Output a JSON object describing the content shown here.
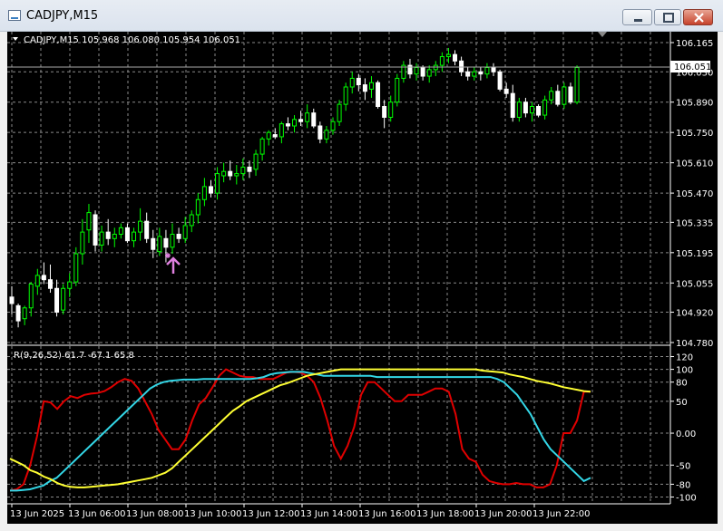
{
  "window": {
    "title": "CADJPY,M15"
  },
  "main": {
    "symbol_header": "CADJPY,M15  105.968 106.080 105.954 106.051",
    "price_axis_labels": [
      "106.165",
      "106.030",
      "105.890",
      "105.750",
      "105.610",
      "105.470",
      "105.335",
      "105.195",
      "105.055",
      "104.920",
      "104.780"
    ],
    "current_price_label": "106.051"
  },
  "indicator": {
    "header": "R(9,26,52) 61.7 -67.1 65.8",
    "axis_labels": [
      "120",
      "100",
      "80",
      "50",
      "0.00",
      "-50",
      "-80",
      "-100"
    ]
  },
  "time_axis": {
    "labels": [
      "13 Jun 2025",
      "13 Jun 06:00",
      "13 Jun 08:00",
      "13 Jun 10:00",
      "13 Jun 12:00",
      "13 Jun 14:00",
      "13 Jun 16:00",
      "13 Jun 18:00",
      "13 Jun 20:00",
      "13 Jun 22:00"
    ]
  },
  "colors": {
    "background": "#000000",
    "grid": "#8a8a8a",
    "bull_candle": "#00ff00",
    "bear_candle": "#ffffff",
    "red_line": "#e00000",
    "cyan_line": "#33d6e6",
    "yellow_line": "#ffff33",
    "arrow": "#e080e0"
  },
  "chart_data": {
    "type": "candlestick",
    "ohlc": [
      [
        104.99,
        105.04,
        104.91,
        104.96
      ],
      [
        104.95,
        104.96,
        104.85,
        104.88
      ],
      [
        104.89,
        104.95,
        104.86,
        104.94
      ],
      [
        104.94,
        105.06,
        104.9,
        105.05
      ],
      [
        105.04,
        105.12,
        105.0,
        105.09
      ],
      [
        105.09,
        105.15,
        105.05,
        105.07
      ],
      [
        105.07,
        105.14,
        105.01,
        105.03
      ],
      [
        105.03,
        105.07,
        104.9,
        104.92
      ],
      [
        104.93,
        105.05,
        104.91,
        105.03
      ],
      [
        105.03,
        105.1,
        104.99,
        105.06
      ],
      [
        105.06,
        105.22,
        105.04,
        105.19
      ],
      [
        105.19,
        105.35,
        105.14,
        105.29
      ],
      [
        105.3,
        105.42,
        105.24,
        105.38
      ],
      [
        105.37,
        105.39,
        105.2,
        105.23
      ],
      [
        105.23,
        105.32,
        105.2,
        105.29
      ],
      [
        105.29,
        105.35,
        105.23,
        105.26
      ],
      [
        105.26,
        105.31,
        105.22,
        105.28
      ],
      [
        105.28,
        105.33,
        105.26,
        105.31
      ],
      [
        105.31,
        105.33,
        105.24,
        105.25
      ],
      [
        105.25,
        105.31,
        105.22,
        105.29
      ],
      [
        105.29,
        105.4,
        105.25,
        105.34
      ],
      [
        105.34,
        105.38,
        105.24,
        105.26
      ],
      [
        105.26,
        105.3,
        105.17,
        105.21
      ],
      [
        105.2,
        105.31,
        105.18,
        105.27
      ],
      [
        105.26,
        105.3,
        105.15,
        105.22
      ],
      [
        105.22,
        105.33,
        105.19,
        105.28
      ],
      [
        105.28,
        105.31,
        105.24,
        105.26
      ],
      [
        105.26,
        105.36,
        105.24,
        105.32
      ],
      [
        105.32,
        105.39,
        105.29,
        105.37
      ],
      [
        105.37,
        105.47,
        105.33,
        105.44
      ],
      [
        105.44,
        105.54,
        105.41,
        105.5
      ],
      [
        105.5,
        105.53,
        105.45,
        105.47
      ],
      [
        105.47,
        105.59,
        105.44,
        105.56
      ],
      [
        105.55,
        105.61,
        105.52,
        105.57
      ],
      [
        105.57,
        105.62,
        105.53,
        105.55
      ],
      [
        105.55,
        105.6,
        105.51,
        105.56
      ],
      [
        105.56,
        105.63,
        105.53,
        105.59
      ],
      [
        105.59,
        105.62,
        105.54,
        105.57
      ],
      [
        105.58,
        105.67,
        105.55,
        105.65
      ],
      [
        105.65,
        105.73,
        105.62,
        105.72
      ],
      [
        105.72,
        105.76,
        105.69,
        105.75
      ],
      [
        105.74,
        105.77,
        105.72,
        105.73
      ],
      [
        105.73,
        105.8,
        105.7,
        105.79
      ],
      [
        105.79,
        105.82,
        105.76,
        105.78
      ],
      [
        105.78,
        105.83,
        105.75,
        105.81
      ],
      [
        105.81,
        105.85,
        105.78,
        105.8
      ],
      [
        105.8,
        105.88,
        105.77,
        105.84
      ],
      [
        105.84,
        105.86,
        105.77,
        105.78
      ],
      [
        105.78,
        105.8,
        105.7,
        105.72
      ],
      [
        105.72,
        105.78,
        105.7,
        105.76
      ],
      [
        105.76,
        105.82,
        105.74,
        105.8
      ],
      [
        105.8,
        105.9,
        105.78,
        105.88
      ],
      [
        105.88,
        105.98,
        105.85,
        105.96
      ],
      [
        105.96,
        106.03,
        105.93,
        106.0
      ],
      [
        106.0,
        106.02,
        105.94,
        105.97
      ],
      [
        105.97,
        106.0,
        105.9,
        105.94
      ],
      [
        105.95,
        106.01,
        105.91,
        105.98
      ],
      [
        105.98,
        105.99,
        105.86,
        105.87
      ],
      [
        105.87,
        105.9,
        105.77,
        105.82
      ],
      [
        105.82,
        105.92,
        105.8,
        105.89
      ],
      [
        105.89,
        106.02,
        105.87,
        106.0
      ],
      [
        106.0,
        106.08,
        105.98,
        106.06
      ],
      [
        106.06,
        106.09,
        106.0,
        106.02
      ],
      [
        106.02,
        106.07,
        105.99,
        106.05
      ],
      [
        106.05,
        106.06,
        105.99,
        106.01
      ],
      [
        106.01,
        106.06,
        105.98,
        106.04
      ],
      [
        106.04,
        106.08,
        106.01,
        106.06
      ],
      [
        106.06,
        106.12,
        106.03,
        106.1
      ],
      [
        106.1,
        106.14,
        106.07,
        106.11
      ],
      [
        106.11,
        106.13,
        106.06,
        106.08
      ],
      [
        106.08,
        106.1,
        106.01,
        106.03
      ],
      [
        106.03,
        106.05,
        105.99,
        106.01
      ],
      [
        106.01,
        106.05,
        105.99,
        106.03
      ],
      [
        106.03,
        106.05,
        105.99,
        106.02
      ],
      [
        106.02,
        106.07,
        106.0,
        106.05
      ],
      [
        106.05,
        106.07,
        106.01,
        106.03
      ],
      [
        106.03,
        106.04,
        105.94,
        105.95
      ],
      [
        105.95,
        105.98,
        105.91,
        105.93
      ],
      [
        105.93,
        105.97,
        105.8,
        105.82
      ],
      [
        105.82,
        105.91,
        105.8,
        105.89
      ],
      [
        105.89,
        105.91,
        105.82,
        105.84
      ],
      [
        105.84,
        105.89,
        105.8,
        105.87
      ],
      [
        105.87,
        105.88,
        105.82,
        105.83
      ],
      [
        105.83,
        105.92,
        105.81,
        105.9
      ],
      [
        105.9,
        105.96,
        105.88,
        105.94
      ],
      [
        105.94,
        105.97,
        105.87,
        105.88
      ],
      [
        105.88,
        105.98,
        105.86,
        105.96
      ],
      [
        105.96,
        105.98,
        105.88,
        105.89
      ],
      [
        105.89,
        106.06,
        105.88,
        106.05
      ]
    ],
    "yaxis": {
      "min": 104.78,
      "max": 106.165
    },
    "markers": [
      {
        "index": 25,
        "type": "buy-arrow"
      }
    ],
    "indicator": {
      "type": "line",
      "ylim": [
        -105,
        125
      ],
      "series": [
        {
          "color": "#e00000",
          "values": [
            -90,
            -88,
            -80,
            -50,
            -5,
            50,
            48,
            38,
            50,
            58,
            55,
            60,
            62,
            63,
            66,
            72,
            80,
            85,
            82,
            70,
            50,
            30,
            5,
            -10,
            -25,
            -25,
            -10,
            20,
            45,
            55,
            72,
            90,
            100,
            95,
            90,
            88,
            88,
            85,
            85,
            85,
            90,
            95,
            96,
            95,
            90,
            80,
            55,
            20,
            -20,
            -40,
            -20,
            10,
            60,
            80,
            80,
            70,
            60,
            50,
            50,
            60,
            60,
            60,
            65,
            70,
            70,
            65,
            30,
            -25,
            -40,
            -45,
            -65,
            -75,
            -78,
            -80,
            -80,
            -78,
            -80,
            -80,
            -85,
            -85,
            -80,
            -50,
            0,
            0,
            20,
            65,
            65
          ]
        },
        {
          "color": "#33d6e6",
          "values": [
            -90,
            -90,
            -89,
            -88,
            -85,
            -82,
            -75,
            -70,
            -60,
            -50,
            -40,
            -30,
            -20,
            -10,
            0,
            10,
            20,
            30,
            40,
            50,
            60,
            70,
            76,
            80,
            82,
            83,
            84,
            84,
            84,
            85,
            85,
            85,
            85,
            85,
            85,
            85,
            85,
            86,
            88,
            92,
            94,
            95,
            96,
            96,
            96,
            94,
            92,
            90,
            90,
            90,
            90,
            90,
            90,
            90,
            90,
            88,
            88,
            88,
            88,
            88,
            88,
            88,
            88,
            88,
            88,
            88,
            88,
            88,
            88,
            88,
            88,
            88,
            88,
            85,
            80,
            70,
            60,
            45,
            30,
            10,
            -10,
            -25,
            -35,
            -45,
            -55,
            -65,
            -75,
            -70
          ]
        },
        {
          "color": "#ffff33",
          "values": [
            -40,
            -45,
            -50,
            -58,
            -62,
            -68,
            -72,
            -78,
            -82,
            -84,
            -85,
            -85,
            -84,
            -83,
            -82,
            -81,
            -80,
            -78,
            -76,
            -74,
            -72,
            -70,
            -66,
            -62,
            -55,
            -45,
            -35,
            -25,
            -15,
            -5,
            5,
            15,
            25,
            35,
            42,
            50,
            55,
            60,
            65,
            70,
            75,
            78,
            82,
            86,
            90,
            92,
            94,
            96,
            98,
            100,
            100,
            100,
            100,
            100,
            100,
            100,
            100,
            100,
            100,
            100,
            100,
            100,
            100,
            100,
            100,
            100,
            100,
            100,
            100,
            100,
            98,
            97,
            96,
            95,
            92,
            90,
            88,
            85,
            82,
            80,
            78,
            75,
            72,
            70,
            68,
            66,
            65
          ]
        }
      ]
    }
  }
}
